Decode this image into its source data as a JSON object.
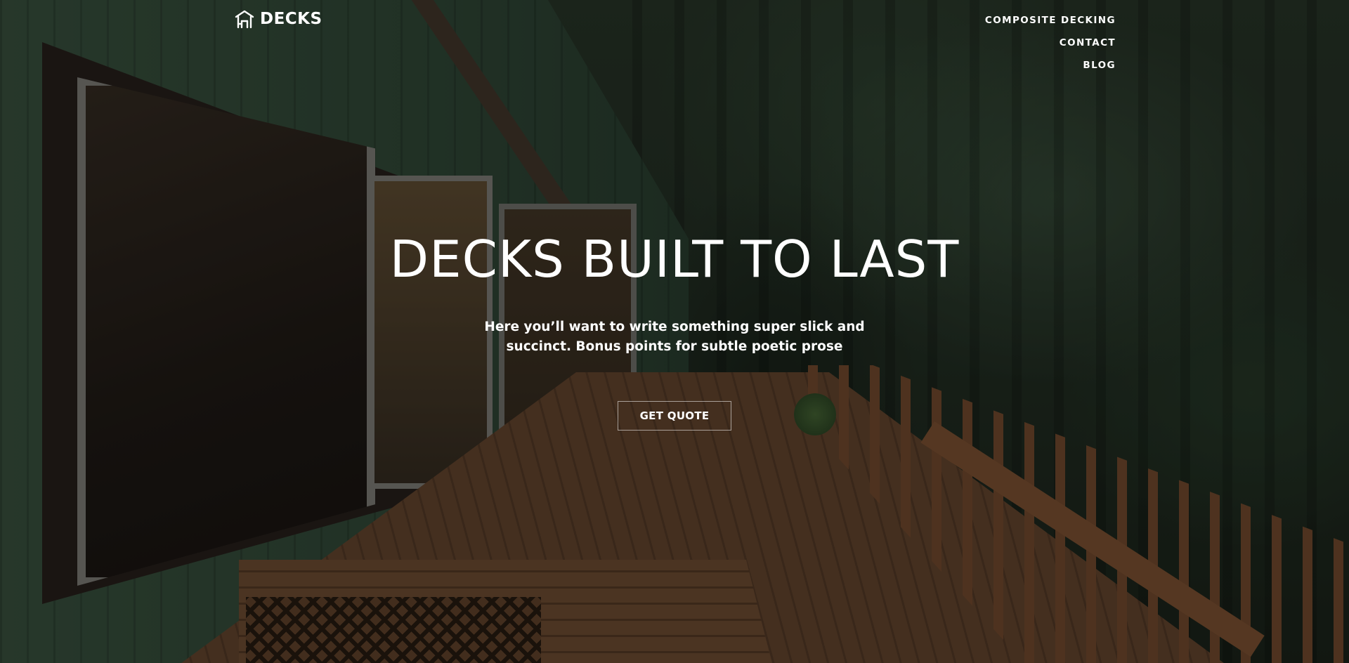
{
  "brand": {
    "name": "DECKS",
    "icon": "house-icon"
  },
  "nav": {
    "items": [
      {
        "label": "COMPOSITE DECKING"
      },
      {
        "label": "CONTACT"
      },
      {
        "label": "BLOG"
      }
    ]
  },
  "hero": {
    "title": "DECKS BUILT TO LAST",
    "subtitle_line1": "Here you’ll want to write something super slick and",
    "subtitle_line2": "succinct. Bonus points for subtle poetic prose",
    "cta_label": "GET QUOTE"
  },
  "colors": {
    "text": "#ffffff",
    "overlay": "rgba(0,0,0,0.38)",
    "button_border": "rgba(255,255,255,0.55)"
  }
}
